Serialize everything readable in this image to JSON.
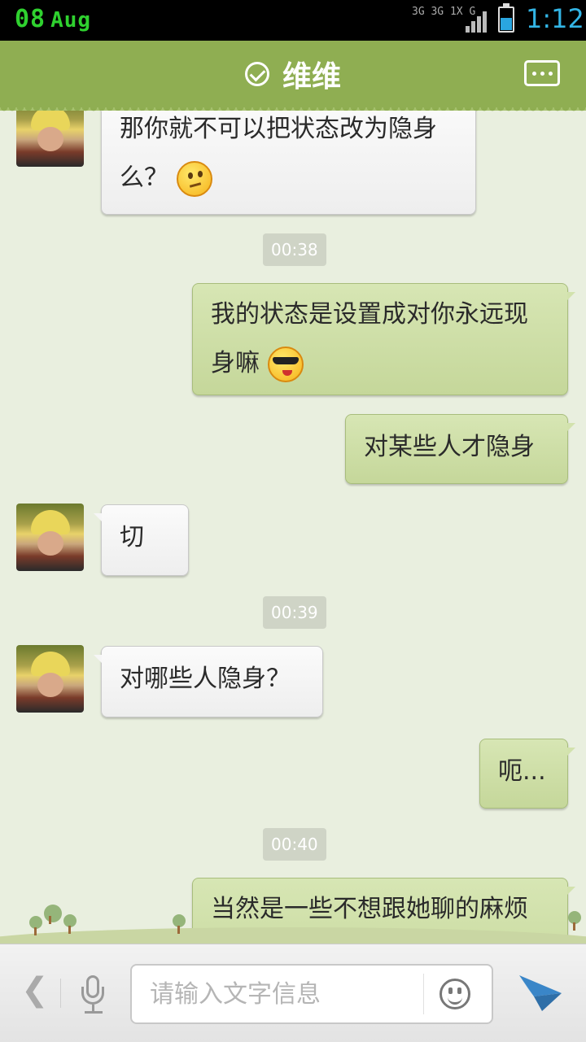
{
  "status_bar": {
    "date_day": "08",
    "date_month": "Aug",
    "network_labels": [
      "3G",
      "3G 1X",
      "G"
    ],
    "time": "1:12",
    "accent_color": "#33b5e5"
  },
  "header": {
    "title": "维维",
    "online_icon": "check-circle-icon",
    "menu_icon": "more-icon",
    "color": "#8fae52"
  },
  "messages": [
    {
      "type": "in",
      "text": "那你就不可以把状态改为隐身么？",
      "emoji": "thinking-emoji"
    },
    {
      "type": "time",
      "text": "00:38"
    },
    {
      "type": "out",
      "text": "我的状态是设置成对你永远现身嘛",
      "emoji": "cool-emoji"
    },
    {
      "type": "out",
      "text": "对某些人才隐身"
    },
    {
      "type": "in",
      "text": "切"
    },
    {
      "type": "time",
      "text": "00:39"
    },
    {
      "type": "in",
      "text": "对哪些人隐身？"
    },
    {
      "type": "out",
      "text": "呃..."
    },
    {
      "type": "time",
      "text": "00:40"
    },
    {
      "type": "out",
      "text": "当然是一些不想跟她聊的麻烦的人"
    }
  ],
  "input_bar": {
    "back_icon": "chevron-left-icon",
    "mic_icon": "microphone-icon",
    "placeholder": "请输入文字信息",
    "emoji_icon": "smiley-icon",
    "send_icon": "send-icon"
  }
}
